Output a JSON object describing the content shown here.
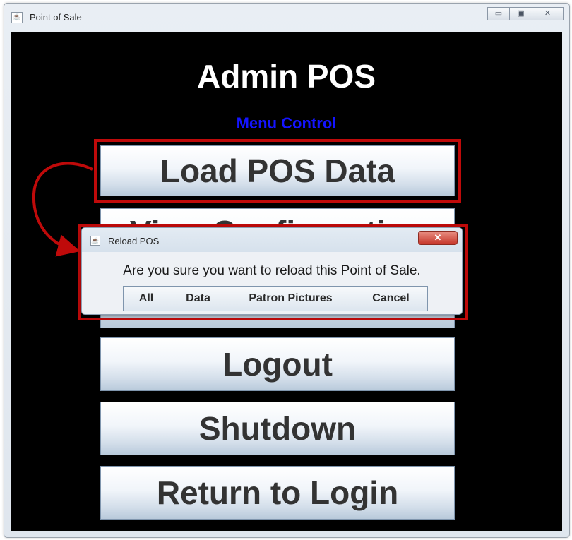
{
  "window": {
    "title": "Point of Sale",
    "controls": {
      "minimize": "▭",
      "maximize": "▣",
      "close": "✕"
    }
  },
  "screen": {
    "title": "Admin POS",
    "subtitle": "Menu Control",
    "menu_buttons": [
      {
        "label": "Load POS Data"
      },
      {
        "label": "View Configuration"
      },
      {
        "label": "Logout"
      },
      {
        "label": "Shutdown"
      },
      {
        "label": "Return to Login"
      }
    ]
  },
  "dialog": {
    "title": "Reload POS",
    "close_glyph": "✕",
    "message": "Are you sure you want to reload this Point of Sale.",
    "buttons": [
      {
        "label": "All"
      },
      {
        "label": "Data"
      },
      {
        "label": "Patron Pictures"
      },
      {
        "label": "Cancel"
      }
    ]
  },
  "icons": {
    "app": "java-cup-icon",
    "dialog": "java-cup-icon"
  },
  "colors": {
    "highlight": "#bf0a0a",
    "subtitle": "#1414ff",
    "background": "#000000"
  }
}
